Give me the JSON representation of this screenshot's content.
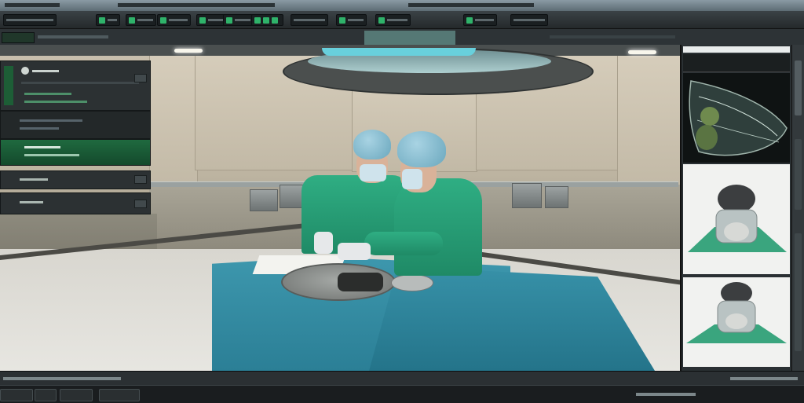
{
  "app": {
    "title": "",
    "accent": "#2fb36a",
    "panel_bg": "#2c3133"
  },
  "toolbar": {
    "buttons": [
      "green-square-icon",
      "green-square-icon",
      "green-square-icon",
      "green-square-icon",
      "green-square-icon",
      "green-square-icon",
      "green-square-icon",
      "green-square-icon"
    ]
  },
  "left_panel": {
    "row_labels": [
      "",
      "",
      "",
      "",
      ""
    ]
  },
  "right_panel": {
    "thumbnails": [
      "eye-scan-image",
      "surgeon-helmet-image",
      "surgeon-helmet-image"
    ]
  },
  "status": {
    "left_text": "",
    "right_text": ""
  }
}
